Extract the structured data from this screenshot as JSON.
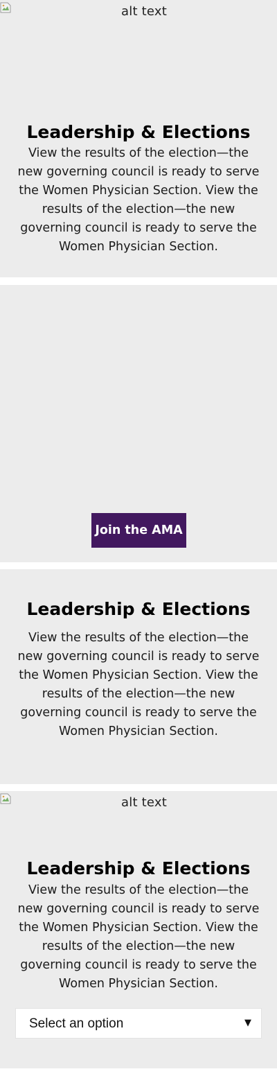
{
  "sections": [
    {
      "image_alt": "alt text",
      "heading": "Leadership & Elections",
      "body": "View the results of the election—the new governing council is ready to serve the Women Physician Section. View the results of the election—the new governing council is ready to serve the Women Physician Section."
    },
    {
      "button_label": "Join the AMA"
    },
    {
      "heading": "Leadership & Elections",
      "body": "View the results of the election—the new governing council is ready to serve the Women Physician Section. View the results of the election—the new governing council is ready to serve the Women Physician Section."
    },
    {
      "image_alt": "alt text",
      "heading": "Leadership & Elections",
      "body": "View the results of the election—the new governing council is ready to serve the Women Physician Section. View the results of the election—the new governing council is ready to serve the Women Physician Section.",
      "select": {
        "selected": "Select an option"
      }
    }
  ],
  "colors": {
    "card_background": "#ececec",
    "button_background": "#42185f",
    "button_text": "#ffffff"
  },
  "icons": {
    "broken_image": "broken-image-icon",
    "select_caret": "caret-down-icon"
  }
}
